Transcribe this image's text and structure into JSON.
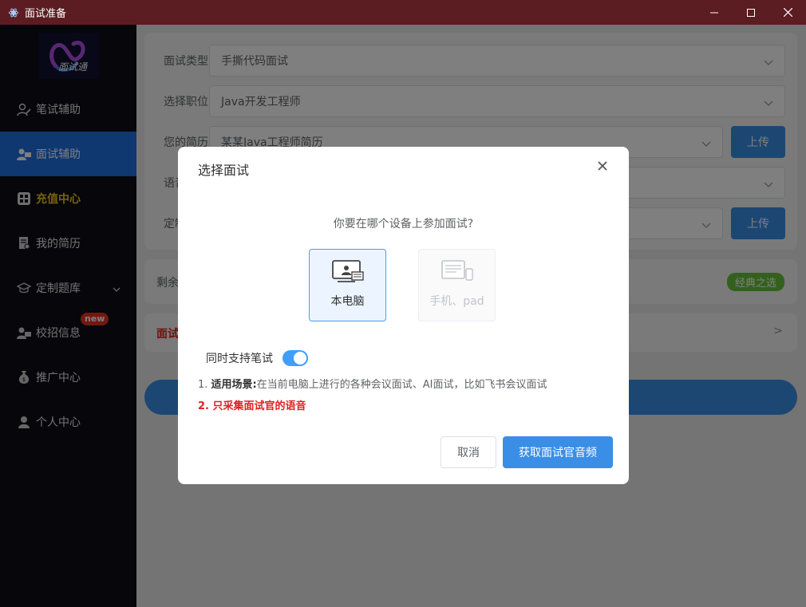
{
  "window": {
    "title": "面试准备",
    "minimize_icon": "minimize-icon",
    "maximize_icon": "maximize-icon",
    "close_icon": "close-icon"
  },
  "sidebar": {
    "logo_text": "面试通",
    "items": [
      {
        "label": "笔试辅助",
        "icon": "pen-user-icon"
      },
      {
        "label": "面试辅助",
        "icon": "interview-user-icon",
        "active": true
      },
      {
        "label": "充值中心",
        "icon": "grid-icon"
      },
      {
        "label": "我的简历",
        "icon": "resume-icon"
      },
      {
        "label": "定制题库",
        "icon": "graduation-cap-icon"
      },
      {
        "label": "校招信息",
        "icon": "campus-user-icon",
        "badge": "new"
      },
      {
        "label": "推广中心",
        "icon": "money-bag-icon"
      },
      {
        "label": "个人中心",
        "icon": "user-icon"
      }
    ]
  },
  "form": {
    "interview_type": {
      "label": "面试类型",
      "value": "手撕代码面试"
    },
    "position": {
      "label": "选择职位",
      "value": "Java开发工程师"
    },
    "resume": {
      "label": "您的简历",
      "value": "某某Java工程师简历",
      "upload": "上传"
    },
    "voice": {
      "label": "语音"
    },
    "custom": {
      "label": "定制",
      "upload": "上传"
    },
    "remaining": {
      "label": "剩余",
      "tag": "经典之选"
    },
    "interview_link": {
      "label": "面试",
      "chevron": ">"
    }
  },
  "dialog": {
    "title": "选择面试",
    "question": "你要在哪个设备上参加面试?",
    "devices": [
      {
        "label": "本电脑",
        "selected": true
      },
      {
        "label": "手机、pad",
        "disabled": true
      }
    ],
    "switch_label": "同时支持笔试",
    "switch_on": true,
    "note1_prefix": "1. ",
    "note1_bold": "适用场景:",
    "note1_text": "在当前电脑上进行的各种会议面试、AI面试，比如飞书会议面试",
    "note2": "2. 只采集面试官的语音",
    "cancel": "取消",
    "confirm": "获取面试官音频"
  },
  "colors": {
    "titlebar": "#5b1d22",
    "sidebar": "#0d0d17",
    "active": "#1f6fe0",
    "primary": "#3a8ee6",
    "gold": "#f0c419",
    "danger": "#e02020",
    "success": "#67c23a"
  }
}
